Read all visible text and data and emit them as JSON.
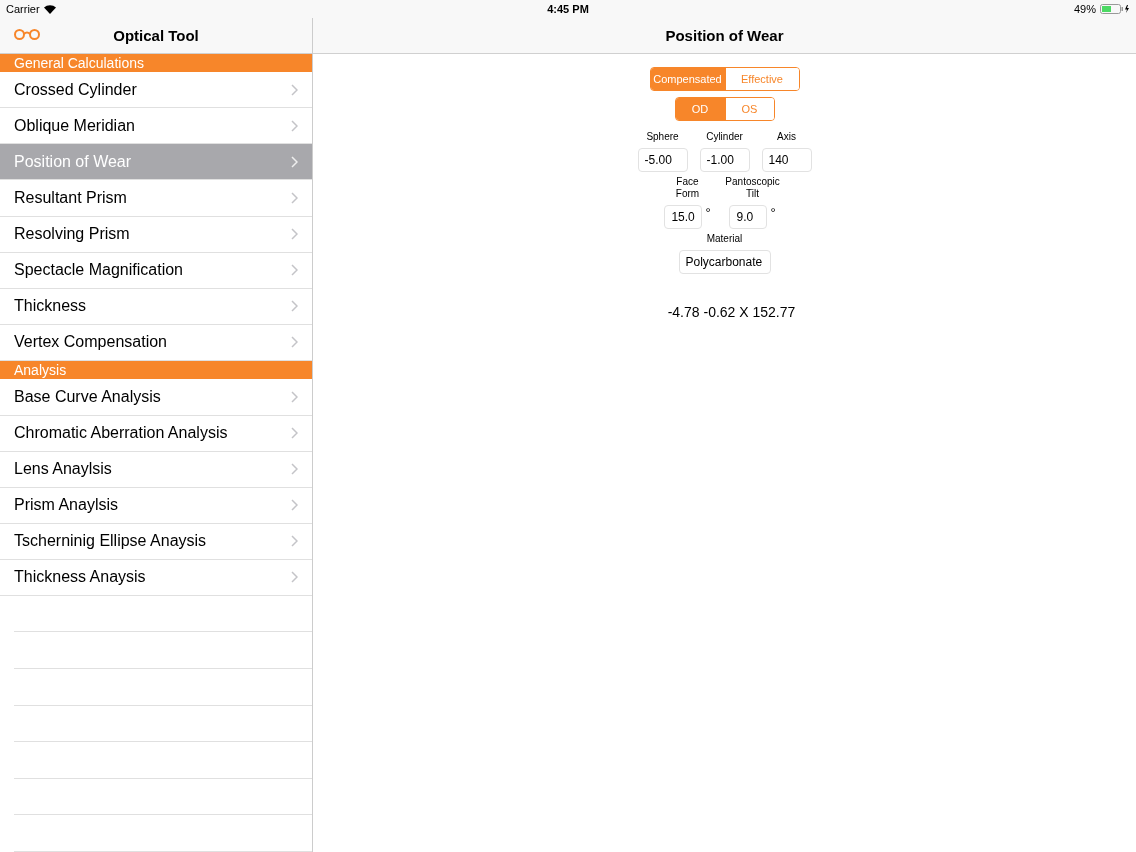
{
  "status_bar": {
    "carrier": "Carrier",
    "time": "4:45 PM",
    "battery": "49%"
  },
  "sidebar": {
    "title": "Optical Tool",
    "sections": [
      {
        "header": "General Calculations",
        "items": [
          {
            "label": "Crossed Cylinder",
            "selected": false
          },
          {
            "label": "Oblique Meridian",
            "selected": false
          },
          {
            "label": "Position of Wear",
            "selected": true
          },
          {
            "label": "Resultant Prism",
            "selected": false
          },
          {
            "label": "Resolving Prism",
            "selected": false
          },
          {
            "label": "Spectacle Magnification",
            "selected": false
          },
          {
            "label": "Thickness",
            "selected": false
          },
          {
            "label": "Vertex Compensation",
            "selected": false
          }
        ]
      },
      {
        "header": "Analysis",
        "items": [
          {
            "label": "Base Curve Analysis",
            "selected": false
          },
          {
            "label": "Chromatic Aberration Analysis",
            "selected": false
          },
          {
            "label": "Lens Anaylsis",
            "selected": false
          },
          {
            "label": "Prism Anaylsis",
            "selected": false
          },
          {
            "label": "Tscherninig Ellipse Anaysis",
            "selected": false
          },
          {
            "label": "Thickness Anaysis",
            "selected": false
          }
        ]
      }
    ]
  },
  "detail": {
    "title": "Position of Wear",
    "mode": [
      {
        "label": "Compensated",
        "selected": true
      },
      {
        "label": "Effective",
        "selected": false
      }
    ],
    "eye": [
      {
        "label": "OD",
        "selected": true
      },
      {
        "label": "OS",
        "selected": false
      }
    ],
    "fields": [
      {
        "label": "Sphere",
        "value": "-5.00"
      },
      {
        "label": "Cylinder",
        "value": "-1.00"
      },
      {
        "label": "Axis",
        "value": "140"
      }
    ],
    "angle_fields": [
      {
        "label": "Face Form",
        "value": "15.0",
        "unit": "°"
      },
      {
        "label": "Pantoscopic Tilt",
        "value": "9.0",
        "unit": "°"
      }
    ],
    "material": {
      "label": "Material",
      "value": "Polycarbonate"
    },
    "result": "-4.78 -0.62 X 152.77"
  }
}
